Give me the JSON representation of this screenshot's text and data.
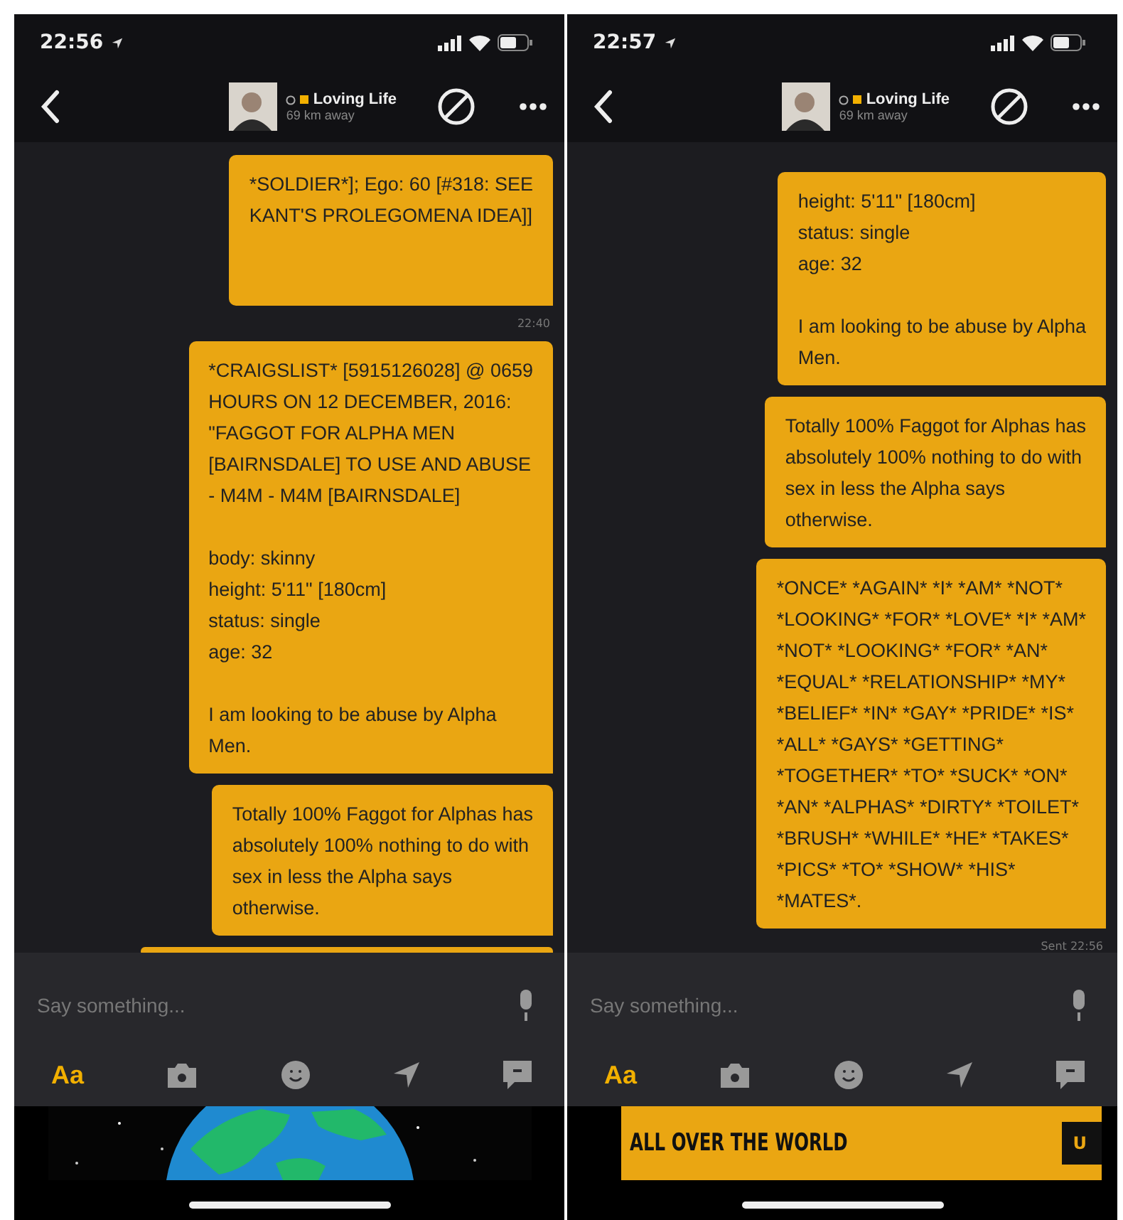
{
  "phones": [
    {
      "status_bar": {
        "time": "22:56"
      },
      "header": {
        "name": "Loving Life",
        "distance": "69 km away",
        "online": true
      },
      "messages": [
        {
          "kind": "message",
          "text": "*SOLDIER*]; Ego: 60 [#318: SEE\nKANT'S PROLEGOMENA IDEA]]\n\n\n"
        },
        {
          "kind": "timestamp",
          "text": "22:40"
        },
        {
          "kind": "message",
          "text": "*CRAIGSLIST* [5915126028] @ 0659\nHOURS ON 12 DECEMBER, 2016:\n\"FAGGOT FOR ALPHA MEN\n[BAIRNSDALE] TO USE AND ABUSE\n- M4M - M4M [BAIRNSDALE]\n\nbody: skinny\nheight: 5'11\" [180cm]\nstatus: single\nage: 32\n\nI am looking to be abuse by Alpha\nMen."
        },
        {
          "kind": "message",
          "text": "Totally 100% Faggot for Alphas has\nabsolutely 100% nothing to do with\nsex in less the Alpha says\notherwise."
        },
        {
          "kind": "stub"
        }
      ],
      "input": {
        "placeholder": "Say something..."
      },
      "toolbar": [
        {
          "label": "Aa",
          "selected": true
        },
        {
          "selected": false
        },
        {
          "selected": false
        },
        {
          "selected": false
        },
        {
          "selected": false
        }
      ]
    },
    {
      "status_bar": {
        "time": "22:57"
      },
      "header": {
        "name": "Loving Life",
        "distance": "69 km away",
        "online": true
      },
      "messages": [
        {
          "kind": "message",
          "text": "height: 5'11\" [180cm]\nstatus: single\nage: 32\n\nI am looking to be abuse by Alpha\nMen."
        },
        {
          "kind": "message",
          "text": "Totally 100% Faggot for Alphas has\nabsolutely 100% nothing to do with\nsex in less the Alpha says\notherwise."
        },
        {
          "kind": "message",
          "text": "*ONCE* *AGAIN* *I* *AM* *NOT*\n*LOOKING* *FOR* *LOVE* *I* *AM*\n*NOT* *LOOKING* *FOR* *AN*\n*EQUAL* *RELATIONSHIP* *MY*\n*BELIEF* *IN* *GAY* *PRIDE* *IS*\n*ALL* *GAYS* *GETTING*\n*TOGETHER* *TO* *SUCK* *ON*\n*AN* *ALPHAS* *DIRTY* *TOILET*\n*BRUSH* *WHILE* *HE* *TAKES*\n*PICS* *TO* *SHOW* *HIS*\n*MATES*."
        },
        {
          "kind": "timestamp",
          "text": "Sent 22:56"
        }
      ],
      "input": {
        "placeholder": "Say something..."
      },
      "toolbar": [
        {
          "label": "Aa",
          "selected": true
        },
        {
          "selected": false
        },
        {
          "selected": false
        },
        {
          "selected": false
        },
        {
          "selected": false
        }
      ],
      "banner": {
        "kind": "ad",
        "text": "ALL OVER THE WORLD",
        "button": "U"
      }
    }
  ]
}
